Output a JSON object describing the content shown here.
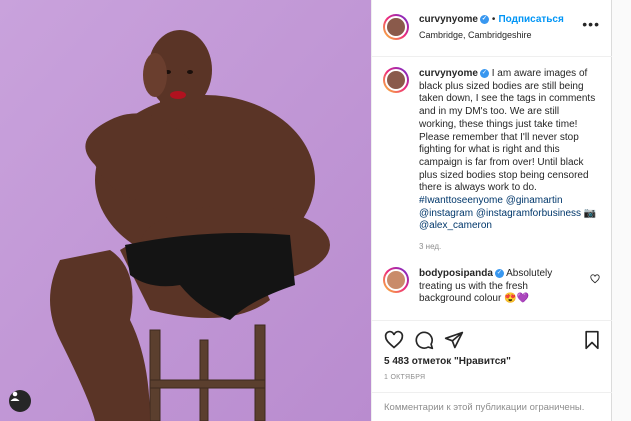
{
  "header": {
    "username": "curvynyome",
    "separator": "•",
    "follow_label": "Подписаться",
    "location": "Cambridge, Cambridgeshire",
    "more_label": "•••"
  },
  "caption": {
    "username": "curvynyome",
    "text": "I am aware images of black plus sized bodies are still being taken down, I see the tags in comments and in my DM's too. We are still working, these things just take time! Please remember that I'll never stop fighting for what is right and this campaign is far from over! Until black plus sized bodies stop being censored there is always work to do.",
    "hashtag": "#Iwanttoseenyome",
    "mention_1": "@ginamartin",
    "mention_2": "@instagram",
    "mention_3": "@instagramforbusiness",
    "camera": "📷",
    "mention_4": "@alex_cameron",
    "time": "3 нед."
  },
  "comment": {
    "username": "bodyposipanda",
    "text": "Absolutely treating us with the fresh background colour",
    "emoji": "😍💜"
  },
  "likes_text": "5 483 отметок \"Нравится\"",
  "date": "1 ОКТЯБРЯ",
  "comments_closed": "Комментарии к этой публикации ограничены.",
  "colors": {
    "photo_background": "#c59ad8",
    "link": "#00376b",
    "follow": "#0095f6",
    "verified": "#3897f0",
    "muted": "#8e8e8e"
  },
  "icons": {
    "header_avatar": "avatar-icon",
    "verified": "verified-badge-icon",
    "tag": "user-tag-icon",
    "like": "heart-icon",
    "comment": "comment-icon",
    "share": "paper-plane-icon",
    "save": "bookmark-icon",
    "comment_like": "small-heart-icon"
  }
}
